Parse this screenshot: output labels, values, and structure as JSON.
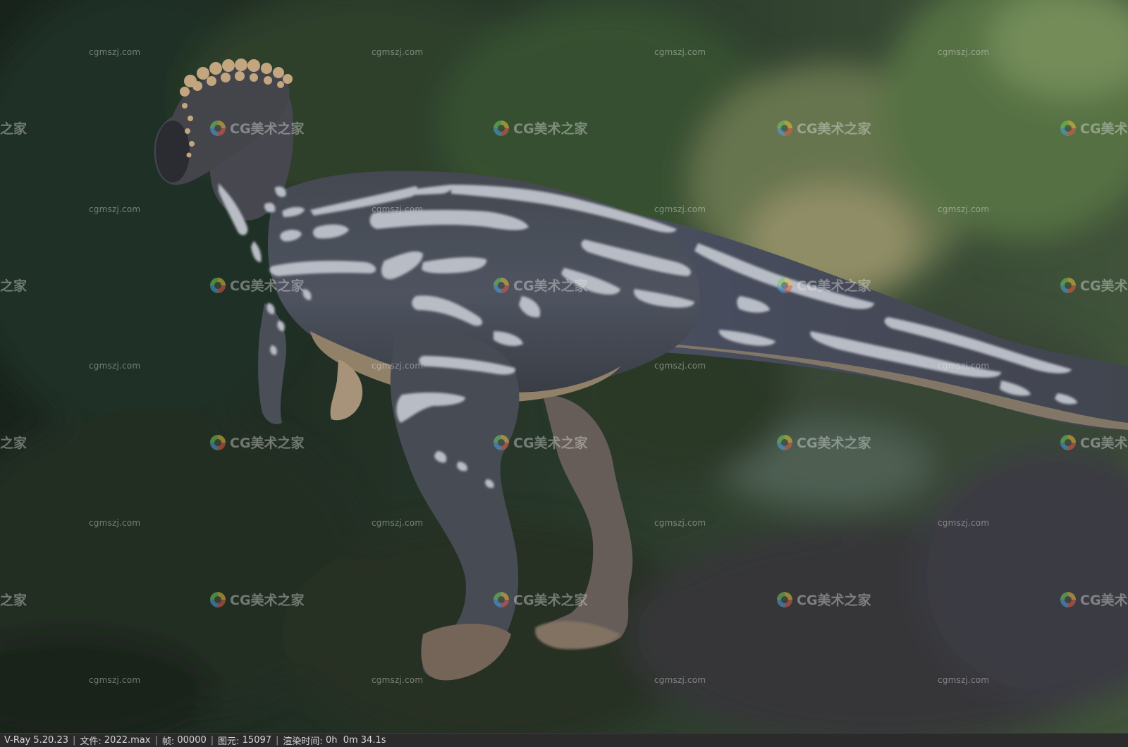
{
  "viewport": {
    "subject": "dinosaur-render",
    "colors": {
      "foliage_dark": "#1e2a22",
      "foliage_mid": "#3d5a3c",
      "foliage_light": "#8aa070",
      "skin_grey": "#4e5562",
      "stripe": "#c9ccd4",
      "belly": "#a89478",
      "crest_bumps": "#d8b88e"
    }
  },
  "watermarks": {
    "small_text": "cgmszj.com",
    "logo_text": "CG美术之家",
    "logo_text_cut": "之家",
    "logo_text_cut_right": "CG美术"
  },
  "statusbar": {
    "renderer": "V-Ray 5.20.23",
    "file_label": "文件:",
    "file_value": "2022.max",
    "frame_label": "帧:",
    "frame_value": "00000",
    "primitives_label": "图元:",
    "primitives_value": "15097",
    "render_time_label": "渲染时间:",
    "render_time_value": "0h  0m 34.1s"
  }
}
